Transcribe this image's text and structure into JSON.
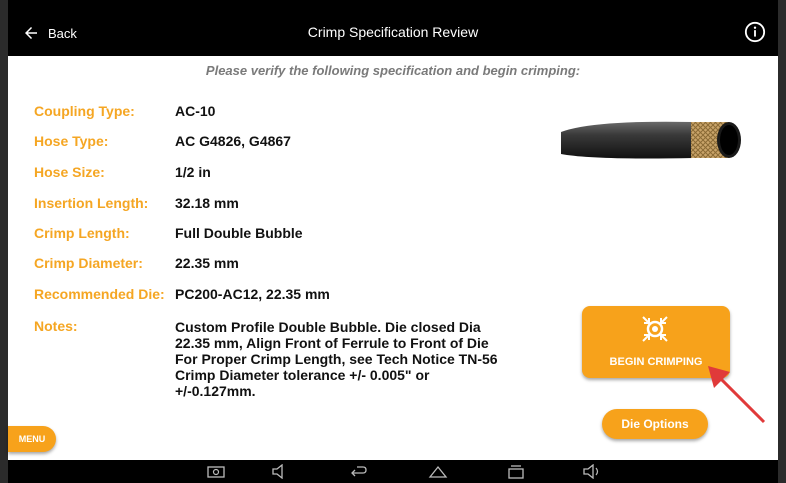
{
  "header": {
    "back_label": "Back",
    "title": "Crimp Specification Review"
  },
  "subtitle": "Please verify the following specification and begin crimping:",
  "spec": {
    "coupling_type": {
      "label": "Coupling Type:",
      "value": "AC-10"
    },
    "hose_type": {
      "label": "Hose Type:",
      "value": "AC G4826, G4867"
    },
    "hose_size": {
      "label": "Hose Size:",
      "value": "1/2 in"
    },
    "insertion_length": {
      "label": "Insertion Length:",
      "value": "32.18 mm"
    },
    "crimp_length": {
      "label": "Crimp Length:",
      "value": "Full Double Bubble"
    },
    "crimp_diameter": {
      "label": "Crimp Diameter:",
      "value": "22.35 mm"
    },
    "recommended_die": {
      "label": "Recommended Die:",
      "value": "PC200-AC12, 22.35 mm"
    },
    "notes": {
      "label": "Notes:",
      "value": "Custom Profile Double Bubble.    Die closed Dia 22.35  mm, Align Front of Ferrule to Front of Die For Proper Crimp Length, see Tech Notice TN-56    Crimp Diameter tolerance +/- 0.005\" or +/-0.127mm."
    }
  },
  "buttons": {
    "begin_crimping": "BEGIN CRIMPING",
    "die_options": "Die Options",
    "menu": "MENU"
  },
  "colors": {
    "accent": "#f7a21b",
    "label": "#f5a623",
    "header_bg": "#000000"
  }
}
